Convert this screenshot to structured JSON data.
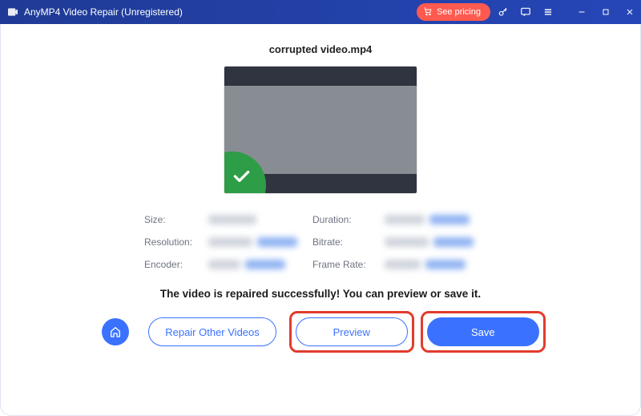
{
  "titlebar": {
    "app_name": "AnyMP4 Video Repair (Unregistered)",
    "pricing_label": "See pricing"
  },
  "main": {
    "filename": "corrupted video.mp4",
    "meta_labels": {
      "size": "Size:",
      "duration": "Duration:",
      "resolution": "Resolution:",
      "bitrate": "Bitrate:",
      "encoder": "Encoder:",
      "frame_rate": "Frame Rate:"
    },
    "success_message": "The video is repaired successfully! You can preview or save it."
  },
  "buttons": {
    "repair_other": "Repair Other Videos",
    "preview": "Preview",
    "save": "Save"
  }
}
